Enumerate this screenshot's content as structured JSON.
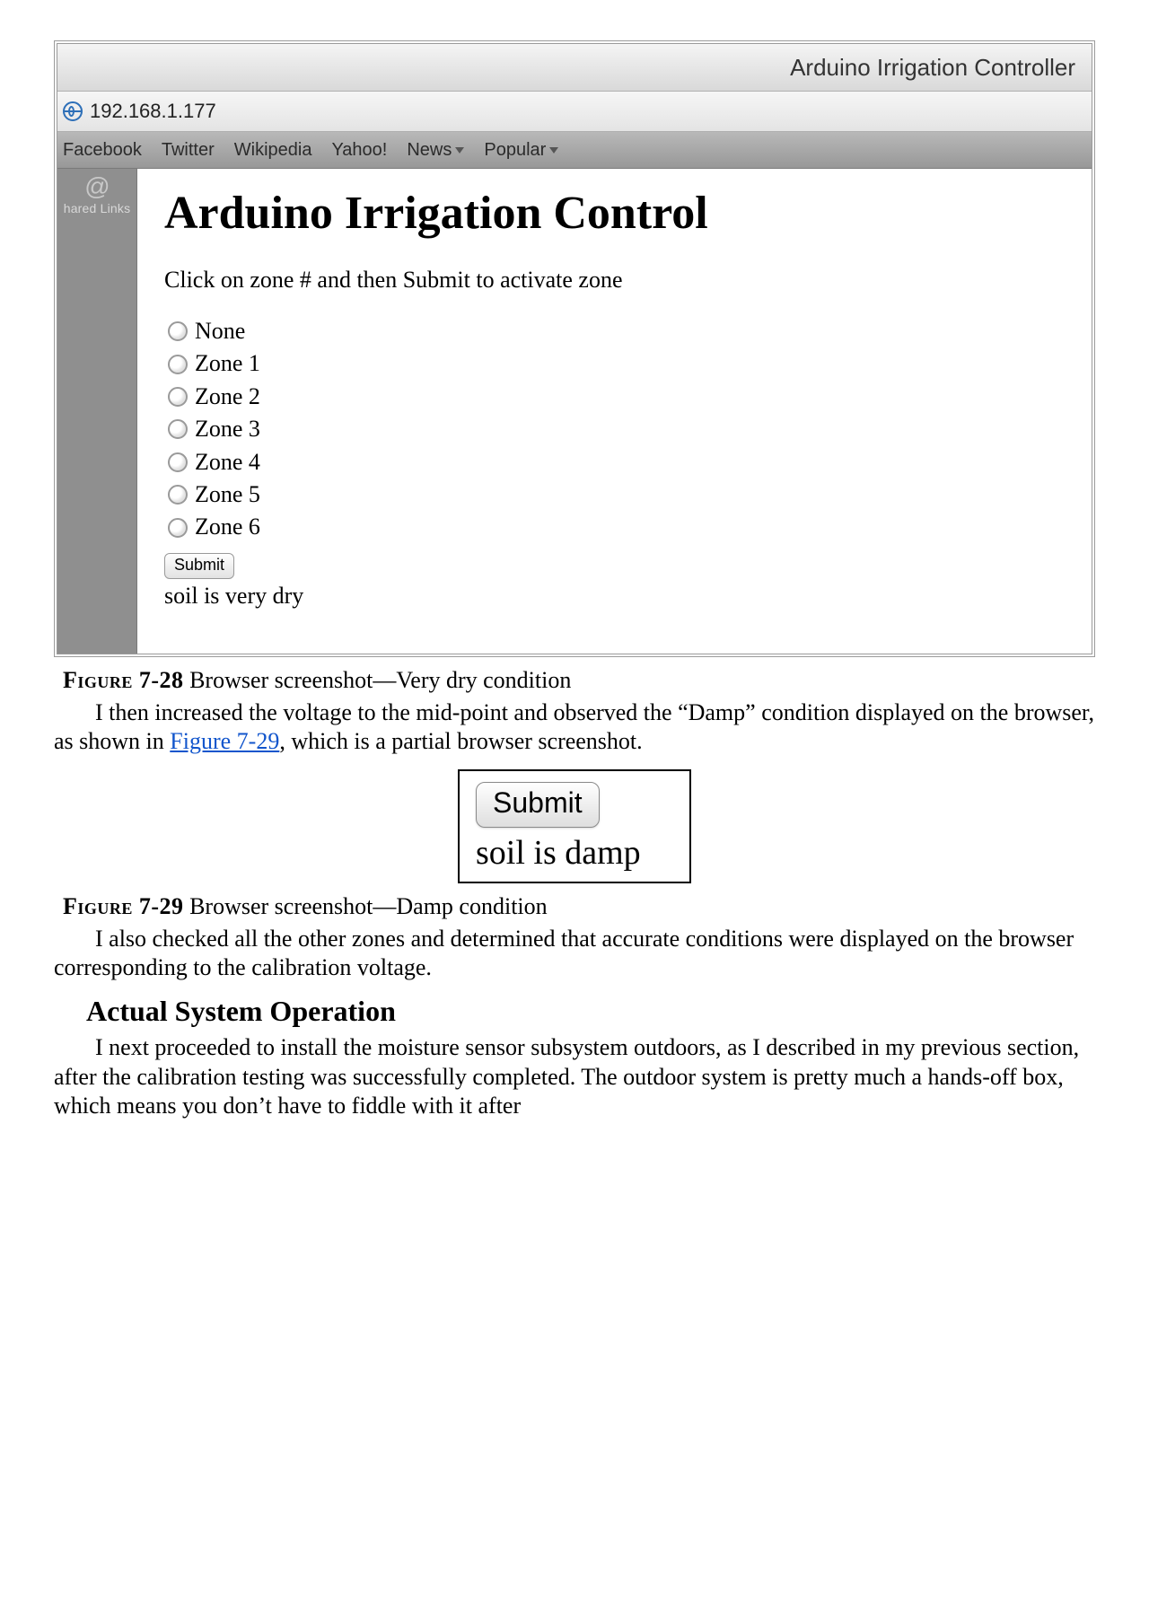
{
  "figure728": {
    "window_title": "Arduino Irrigation Controller",
    "address": "192.168.1.177",
    "bookmarks": {
      "facebook": "Facebook",
      "twitter": "Twitter",
      "wikipedia": "Wikipedia",
      "yahoo": "Yahoo!",
      "news": "News",
      "popular": "Popular"
    },
    "sidebar": {
      "at": "@",
      "label": "hared Links"
    },
    "page": {
      "heading": "Arduino Irrigation Control",
      "instruction": "Click on zone # and then Submit to activate zone",
      "options": [
        "None",
        "Zone 1",
        "Zone 2",
        "Zone 3",
        "Zone 4",
        "Zone 5",
        "Zone 6"
      ],
      "submit_label": "Submit",
      "status": "soil is very dry"
    }
  },
  "captions": {
    "fig728_label": "Figure 7-28",
    "fig728_text": " Browser screenshot—Very dry condition",
    "fig729_label": "Figure 7-29",
    "fig729_text": " Browser screenshot—Damp condition"
  },
  "paragraphs": {
    "p1a": "I then increased the voltage to the mid-point and observed the “Damp” condition displayed on the browser, as shown in ",
    "p1_link": "Figure 7-29",
    "p1b": ", which is a partial browser screenshot.",
    "p2": "I also checked all the other zones and determined that accurate conditions were displayed on the browser corresponding to the calibration voltage.",
    "p3": "I next proceeded to install the moisture sensor subsystem outdoors, as I described in my previous section, after the calibration testing was successfully completed. The outdoor system is pretty much a hands-off box, which means you don’t have to fiddle with it after"
  },
  "figure729": {
    "submit_label": "Submit",
    "status": "soil is damp"
  },
  "headings": {
    "actual_system": "Actual System Operation"
  }
}
